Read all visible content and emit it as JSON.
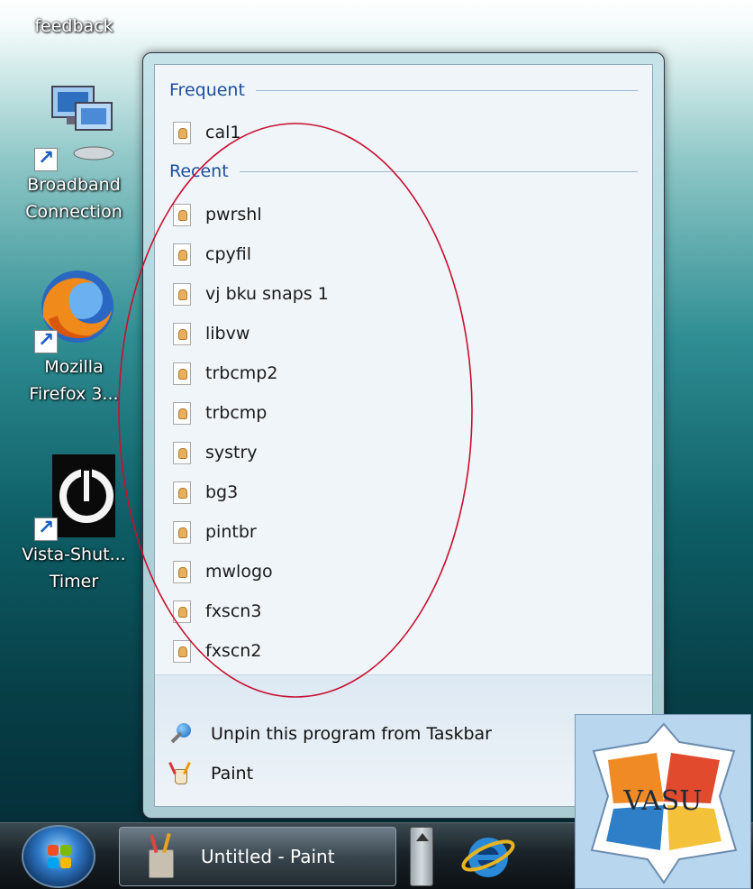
{
  "desktop": {
    "icons": [
      {
        "label": "feedback"
      },
      {
        "label_lines": [
          "Broadband",
          "Connection"
        ]
      },
      {
        "label_lines": [
          "Mozilla",
          "Firefox 3..."
        ]
      },
      {
        "label_lines": [
          "Vista-Shut...",
          "Timer"
        ]
      }
    ]
  },
  "jump_list": {
    "frequent_header": "Frequent",
    "frequent_items": [
      "cal1"
    ],
    "recent_header": "Recent",
    "recent_items": [
      "pwrshl",
      "cpyfil",
      "vj bku snaps 1",
      "libvw",
      "trbcmp2",
      "trbcmp",
      "systry",
      "bg3",
      "pintbr",
      "mwlogo",
      "fxscn3",
      "fxscn2"
    ],
    "tasks": {
      "unpin": "Unpin this program from Taskbar",
      "app": "Paint"
    }
  },
  "taskbar": {
    "paint_button_label": "Untitled - Paint"
  },
  "watermark": {
    "text": "VASU"
  },
  "colors": {
    "annotation": "#c8102e",
    "section_header": "#1d4e9e"
  }
}
